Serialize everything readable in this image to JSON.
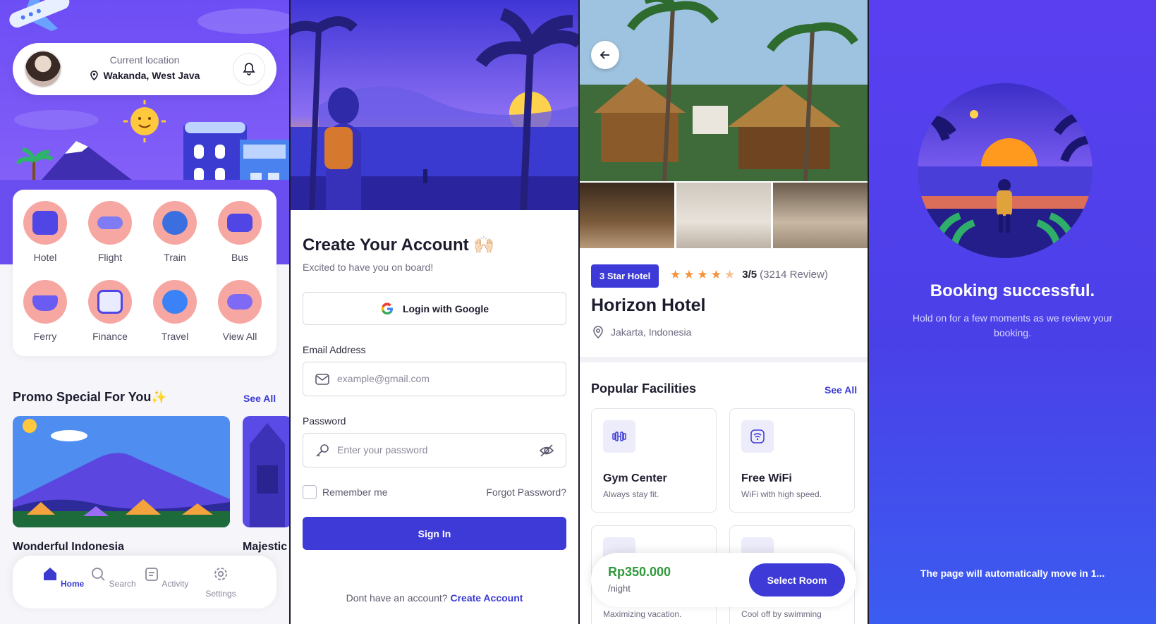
{
  "home": {
    "location_label": "Current location",
    "location_value": "Wakanda, West Java",
    "categories": [
      {
        "label": "Hotel",
        "icon": "hotel-icon"
      },
      {
        "label": "Flight",
        "icon": "flight-icon"
      },
      {
        "label": "Train",
        "icon": "train-icon"
      },
      {
        "label": "Bus",
        "icon": "bus-icon"
      },
      {
        "label": "Ferry",
        "icon": "ferry-icon"
      },
      {
        "label": "Finance",
        "icon": "finance-icon"
      },
      {
        "label": "Travel",
        "icon": "travel-icon"
      },
      {
        "label": "View All",
        "icon": "view-all-icon"
      }
    ],
    "promo_title": "Promo Special For You✨",
    "promo_see_all": "See All",
    "promos": [
      {
        "title": "Wonderful Indonesia"
      },
      {
        "title": "Majestic"
      }
    ],
    "nav": [
      {
        "label": "Home",
        "icon": "home-icon"
      },
      {
        "label": "Search",
        "icon": "search-icon"
      },
      {
        "label": "Activity",
        "icon": "activity-icon"
      },
      {
        "label": "Settings",
        "icon": "settings-icon"
      }
    ]
  },
  "signup": {
    "title": "Create Your Account 🙌🏻",
    "subtitle": "Excited to have you on board!",
    "google_label": "Login with Google",
    "email_label": "Email Address",
    "email_placeholder": "example@gmail.com",
    "password_label": "Password",
    "password_placeholder": "Enter your password",
    "remember_label": "Remember me",
    "forgot_label": "Forgot Password?",
    "signin_label": "Sign In",
    "no_account_text": "Dont have an account?",
    "create_account_link": "Create Account"
  },
  "hotel": {
    "badge": "3 Star Hotel",
    "rating": "3/5",
    "reviews": "(3214 Review)",
    "name": "Horizon Hotel",
    "location": "Jakarta, Indonesia",
    "facilities_title": "Popular Facilities",
    "facilities_see_all": "See All",
    "facilities": [
      {
        "title": "Gym Center",
        "subtitle": "Always stay fit.",
        "icon": "dumbbell-icon"
      },
      {
        "title": "Free WiFi",
        "subtitle": "WiFi with high speed.",
        "icon": "wifi-icon"
      },
      {
        "title": "",
        "subtitle": "Maximizing vacation.",
        "icon": "facility-icon"
      },
      {
        "title": "",
        "subtitle": "Cool off by swimming",
        "icon": "pool-icon"
      }
    ],
    "price": "Rp350.000",
    "per_night": "/night",
    "select_label": "Select Room"
  },
  "success": {
    "title": "Booking successful.",
    "subtitle": "Hold on for a few moments as we review your booking.",
    "footer": "The page will automatically move in 1..."
  },
  "colors": {
    "primary": "#3d3ad8",
    "price": "#2f9a3a",
    "star": "#f4923e",
    "success_bg": "#5a3ff0"
  }
}
